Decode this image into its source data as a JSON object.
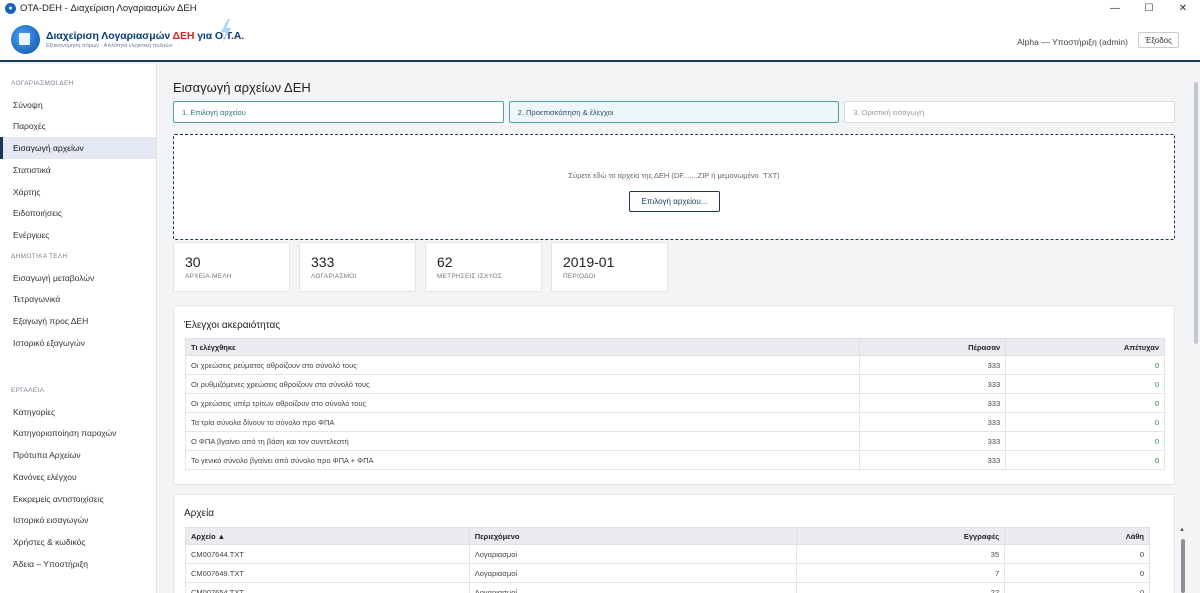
{
  "window": {
    "title": "OTA-DEH - Διαχείριση Λογαριασμών ΔΕΗ",
    "controls": [
      "—",
      "☐",
      "✕"
    ]
  },
  "header": {
    "logo_title_prefix": "Διαχείριση Λογαριασμών ",
    "logo_title_red": "ΔΕΗ",
    "logo_title_suffix": " για Ο.Τ.Α.",
    "logo_subtitle": "Εξοικονόμηση πόρων - Απλότητα ελεγκτική πολιτών",
    "user": "Alpha — Υποστήριξη (admin)",
    "exit_label": "Έξοδος"
  },
  "sidebar": {
    "sections": [
      {
        "title": "ΛΟΓΑΡΙΑΣΜΟΙ ΔΕΗ",
        "items": [
          "Σύνοψη",
          "Παροχές",
          "Εισαγωγή αρχείων",
          "Στατιστικά",
          "Χάρτης",
          "Ειδοποιήσεις",
          "Ενέργειες"
        ]
      },
      {
        "title": "ΔΗΜΟΤΙΚΑ ΤΕΛΗ",
        "items": [
          "Εισαγωγή μεταβολών",
          "Τετραγωνικά",
          "Εξαγωγή προς ΔΕΗ",
          "Ιστορικό εξαγωγών"
        ]
      },
      {
        "title": "ΕΡΓΑΛΕΙΑ",
        "items": [
          "Κατηγορίες",
          "Κατηγοριοποίηση παροχών",
          "Πρότυπα Αρχείων",
          "Κανόνες ελέγχου",
          "Εκκρεμείς αντιστοιχίσεις",
          "Ιστορικό εισαγωγών",
          "Χρήστες & κωδικός",
          "Άδεια – Υποστήριξη"
        ]
      }
    ],
    "active": "Εισαγωγή αρχείων"
  },
  "page": {
    "title": "Εισαγωγή αρχείων ΔΕΗ",
    "steps": [
      "1. Επιλογή αρχείου",
      "2. Προεπισκόπηση & έλεγχοι",
      "3. Οριστική εισαγωγή"
    ],
    "dropzone_text": "Σύρετε εδώ το αρχείο της ΔΕΗ (DF.......ZIP ή μεμονωμένο .TXT)",
    "pick_button": "Επιλογή αρχείου...",
    "stats": [
      {
        "value": "30",
        "label": "ΑΡΧΕΙΑ-ΜΕΛΗ"
      },
      {
        "value": "333",
        "label": "ΛΟΓΑΡΙΑΣΜΟΙ"
      },
      {
        "value": "62",
        "label": "ΜΕΤΡΗΣΕΙΣ ΙΣΧΥΟΣ"
      },
      {
        "value": "2019-01",
        "label": "ΠΕΡΙΟΔΟΙ"
      }
    ]
  },
  "integrity": {
    "title": "Έλεγχοι ακεραιότητας",
    "headers": [
      "Τι ελέγχθηκε",
      "Πέρασαν",
      "Απέτυχαν"
    ],
    "rows": [
      [
        "Οι χρεώσεις ρεύματος αθροίζουν στο σύνολό τους",
        "333",
        "0"
      ],
      [
        "Οι ρυθμιζόμενες χρεώσεις αθροίζουν στο σύνολό τους",
        "333",
        "0"
      ],
      [
        "Οι χρεώσεις υπέρ τρίτων αθροίζουν στο σύνολό τους",
        "333",
        "0"
      ],
      [
        "Τα τρία σύνολα δίνουν το σύνολο προ ΦΠΑ",
        "333",
        "0"
      ],
      [
        "Ο ΦΠΑ βγαίνει από τη βάση και τον συντελεστή",
        "333",
        "0"
      ],
      [
        "Το γενικό σύνολο βγαίνει από σύνολο προ ΦΠΑ + ΦΠΑ",
        "333",
        "0"
      ]
    ]
  },
  "files": {
    "title": "Αρχεία",
    "headers": [
      "Αρχείο ▲",
      "Περιεχόμενο",
      "Εγγραφές",
      "Λάθη"
    ],
    "rows": [
      [
        "CM007644.TXT",
        "Λογαριασμοί",
        "35",
        "0"
      ],
      [
        "CM007649.TXT",
        "Λογαριασμοί",
        "7",
        "0"
      ],
      [
        "CM007654.TXT",
        "Λογαριασμοί",
        "22",
        "0"
      ]
    ]
  }
}
